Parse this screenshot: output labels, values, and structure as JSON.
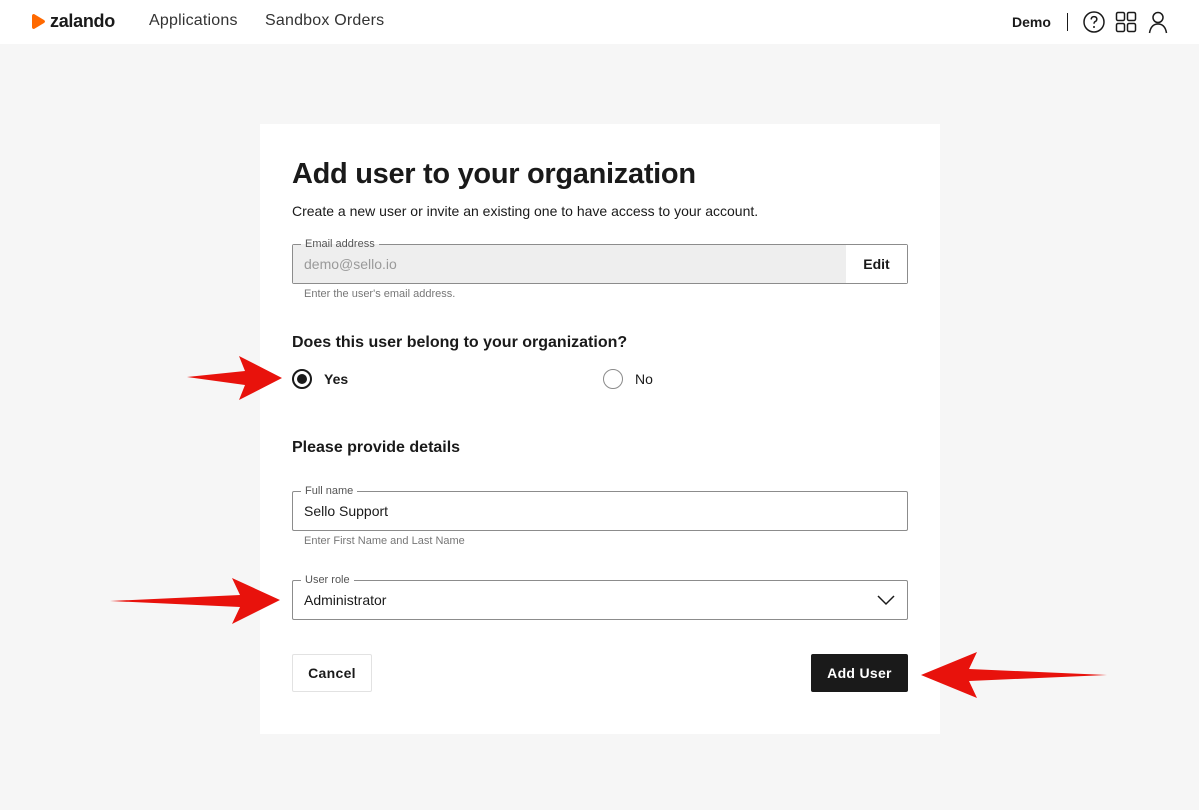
{
  "header": {
    "logo_text": "zalando",
    "nav": [
      "Applications",
      "Sandbox Orders"
    ],
    "org_name": "Demo",
    "icons": [
      "help-icon",
      "apps-grid-icon",
      "user-icon"
    ]
  },
  "form": {
    "title": "Add user to your organization",
    "subtitle": "Create a new user or invite an existing one to have access to your account.",
    "email": {
      "label": "Email address",
      "value": "demo@sello.io",
      "edit_label": "Edit",
      "help": "Enter the user's email address."
    },
    "question": "Does this user belong to your organization?",
    "options": {
      "yes": "Yes",
      "no": "No",
      "selected": "yes"
    },
    "details_title": "Please provide details",
    "full_name": {
      "label": "Full name",
      "value": "Sello Support",
      "help": "Enter First Name and Last Name"
    },
    "role": {
      "label": "User role",
      "value": "Administrator"
    },
    "cancel_label": "Cancel",
    "submit_label": "Add User"
  },
  "colors": {
    "brand_orange": "#ff6900",
    "annotation_red": "#e8120c",
    "primary_button": "#1a1a1a"
  }
}
